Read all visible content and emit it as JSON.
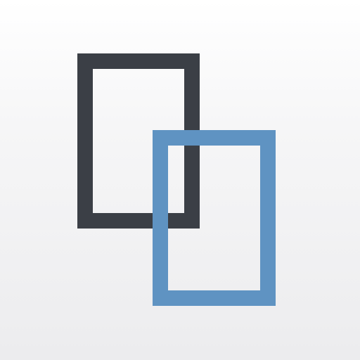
{
  "app_icon": {
    "icon_name": "overlapping-rectangles-icon",
    "colors": {
      "background_top": "#ffffff",
      "background_bottom": "#ececee",
      "back_frame": "#3b3f46",
      "front_frame": "#5f93c2"
    }
  }
}
